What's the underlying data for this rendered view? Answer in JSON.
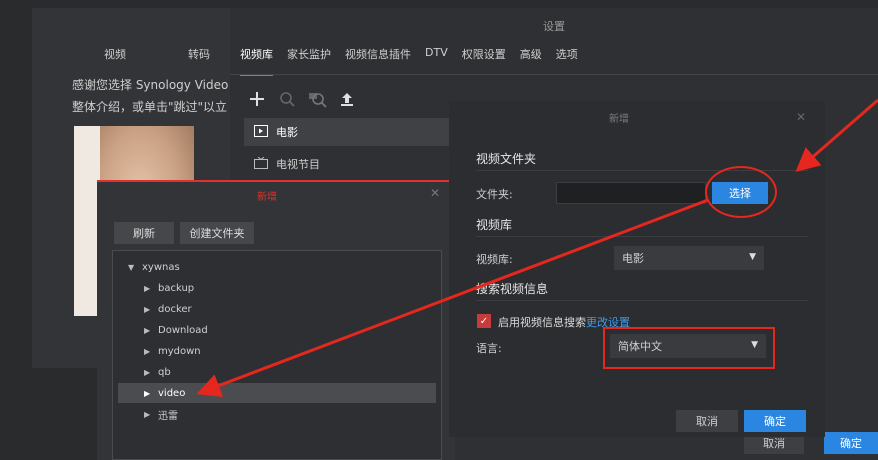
{
  "welcome": {
    "tabs": [
      "视频",
      "转码"
    ],
    "text_line1": "感谢您选择 Synology Video S",
    "text_line2": "整体介绍，或单击\"跳过\"以立"
  },
  "settings": {
    "title": "设置",
    "tabs": [
      "视频库",
      "家长监护",
      "视频信息插件",
      "DTV",
      "权限设置",
      "高级",
      "选项"
    ],
    "active_tab": "视频库",
    "libraries": [
      "电影",
      "电视节目"
    ],
    "cancel_label": "取消",
    "ok_label": "确定"
  },
  "picker": {
    "title": "新增",
    "refresh_label": "刷新",
    "newfolder_label": "创建文件夹",
    "root": "xywnas",
    "folders": [
      "backup",
      "docker",
      "Download",
      "mydown",
      "qb",
      "video",
      "迅雷"
    ],
    "selected": "video"
  },
  "dialog": {
    "title": "新增",
    "section_folder": "视频文件夹",
    "folder_label": "文件夹:",
    "folder_value": "",
    "select_label": "选择",
    "section_library": "视频库",
    "library_label": "视频库:",
    "library_value": "电影",
    "section_search": "搜索视频信息",
    "enable_search_label": "启用视频信息搜索",
    "settings_link": "更改设置",
    "language_label": "语言:",
    "language_value": "简体中文",
    "cancel_label": "取消",
    "ok_label": "确定"
  },
  "colors": {
    "accent": "#2a86e0",
    "annotation": "#e5271f"
  }
}
